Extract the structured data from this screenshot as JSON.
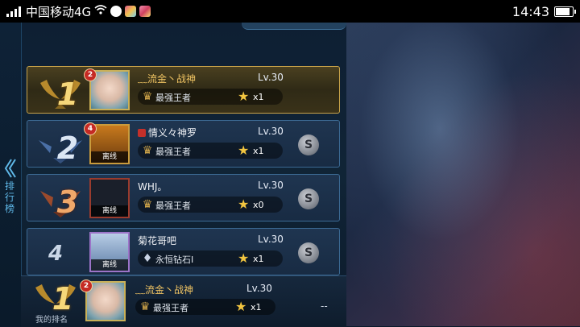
{
  "statusbar": {
    "carrier": "中国移动4G",
    "time": "14:43"
  },
  "leftrail": {
    "label": "排行榜"
  },
  "colors": {
    "gold_accent": "#f0c463",
    "row_border": "#3c6a94",
    "star": "#f2c540"
  },
  "rows": [
    {
      "rank": "1",
      "badge_count": "2",
      "name": "﹏流金丶战神",
      "level": "Lv.30",
      "tier": "最强王者",
      "stars": "x1",
      "status": ""
    },
    {
      "rank": "2",
      "badge_count": "4",
      "name": "情义々神罗",
      "level": "Lv.30",
      "tier": "最强王者",
      "stars": "x1",
      "status": "离线"
    },
    {
      "rank": "3",
      "name": "WHJ。",
      "level": "Lv.30",
      "tier": "最强王者",
      "stars": "x0",
      "status": "离线"
    },
    {
      "rank": "4",
      "name": "菊花哥吧",
      "level": "Lv.30",
      "tier": "永恒钻石I",
      "stars": "x1",
      "status": "离线"
    }
  ],
  "my_rank": {
    "label": "我的排名",
    "rank": "1",
    "badge_count": "2",
    "name": "﹏流金丶战神",
    "level": "Lv.30",
    "tier": "最强王者",
    "stars": "x1",
    "value": "--"
  }
}
